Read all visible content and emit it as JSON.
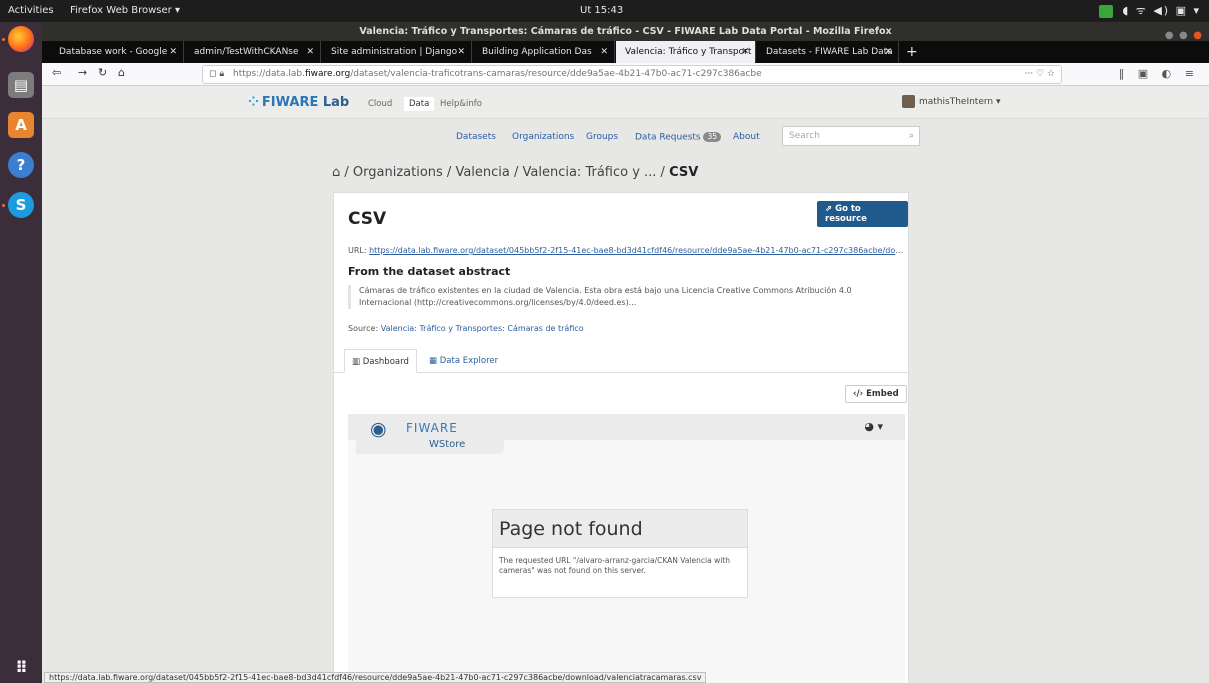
{
  "system": {
    "activities": "Activities",
    "app_menu": "Firefox Web Browser ▾",
    "clock": "Ut 15:43"
  },
  "window": {
    "title": "Valencia: Tráfico y Transportes: Cámaras de tráfico - CSV - FIWARE Lab Data Portal - Mozilla Firefox"
  },
  "tabs": [
    {
      "label": "Database work - Google"
    },
    {
      "label": "admin/TestWithCKANse"
    },
    {
      "label": "Site administration | Django"
    },
    {
      "label": "Building Application Das"
    },
    {
      "label": "Valencia: Tráfico y Transport"
    },
    {
      "label": "Datasets - FIWARE Lab Data"
    }
  ],
  "address": {
    "prefix": "https://data.lab.",
    "domain": "fiware.org",
    "path": "/dataset/valencia-traficotrans-camaras/resource/dde9a5ae-4b21-47b0-ac71-c297c386acbe"
  },
  "masthead": {
    "brand_main": "FIWARE",
    "brand_lab": "Lab",
    "links": [
      "Cloud",
      "Data",
      "Help&info"
    ],
    "user": "mathisTheIntern ▾"
  },
  "secondary_nav": {
    "datasets": "Datasets",
    "organizations": "Organizations",
    "groups": "Groups",
    "data_requests": "Data Requests",
    "data_requests_count": "35",
    "about": "About",
    "search_placeholder": "Search"
  },
  "breadcrumb": {
    "trail": " / Organizations / Valencia / Valencia: Tráfico y ... / ",
    "current": "CSV"
  },
  "resource": {
    "go_button": "Go to resource",
    "title": "CSV",
    "url_label": "URL: ",
    "url": "https://data.lab.fiware.org/dataset/045bb5f2-2f15-41ec-bae8-bd3d41cfdf46/resource/dde9a5ae-4b21-47b0-ac71-c297c386acbe/downl...",
    "from_heading": "From the dataset abstract",
    "abstract": "Cámaras de tráfico existentes en la ciudad de Valencia. Esta obra está bajo una Licencia Creative Commons Atribución 4.0 Internacional (http://creativecommons.org/licenses/by/4.0/deed.es)...",
    "source_label": "Source: ",
    "source_link": "Valencia: Tráfico y Transportes: Cámaras de tráfico",
    "tab_dashboard": "Dashboard",
    "tab_explorer": "Data Explorer",
    "embed": "Embed"
  },
  "wstore": {
    "brand": "FIWARE",
    "sub": "WStore",
    "nf_title": "Page not found",
    "nf_message": "The requested URL \"/alvaro-arranz-garcia/CKAN Valencia with cameras\" was not found on this server."
  },
  "statusbar": "https://data.lab.fiware.org/dataset/045bb5f2-2f15-41ec-bae8-bd3d41cfdf46/resource/dde9a5ae-4b21-47b0-ac71-c297c386acbe/download/valenciatracamaras.csv"
}
